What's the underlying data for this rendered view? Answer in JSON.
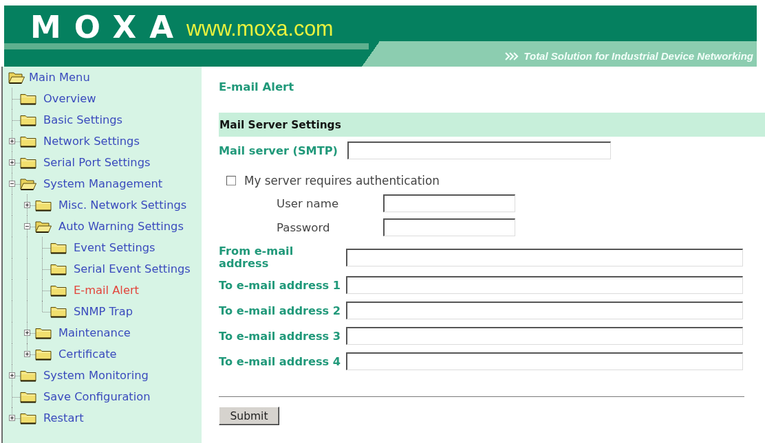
{
  "header": {
    "logo": "MOXA",
    "website": "www.moxa.com",
    "tagline": "Total Solution for Industrial Device Networking"
  },
  "menu": {
    "title": "Main Menu",
    "expanded": true,
    "items": [
      {
        "label": "Overview",
        "kind": "leaf",
        "expanded": false,
        "selected": false
      },
      {
        "label": "Basic Settings",
        "kind": "leaf",
        "expanded": false,
        "selected": false
      },
      {
        "label": "Network Settings",
        "kind": "branch",
        "expanded": false,
        "selected": false
      },
      {
        "label": "Serial Port Settings",
        "kind": "branch",
        "expanded": false,
        "selected": false
      },
      {
        "label": "System Management",
        "kind": "branch",
        "expanded": true,
        "selected": false,
        "children": [
          {
            "label": "Misc. Network Settings",
            "kind": "branch",
            "expanded": false,
            "selected": false
          },
          {
            "label": "Auto Warning Settings",
            "kind": "branch",
            "expanded": true,
            "selected": false,
            "children": [
              {
                "label": "Event Settings",
                "kind": "leaf",
                "expanded": false,
                "selected": false
              },
              {
                "label": "Serial Event Settings",
                "kind": "leaf",
                "expanded": false,
                "selected": false
              },
              {
                "label": "E-mail Alert",
                "kind": "leaf",
                "expanded": false,
                "selected": true
              },
              {
                "label": "SNMP Trap",
                "kind": "leaf",
                "expanded": false,
                "selected": false
              }
            ]
          },
          {
            "label": "Maintenance",
            "kind": "branch",
            "expanded": false,
            "selected": false
          },
          {
            "label": "Certificate",
            "kind": "branch",
            "expanded": false,
            "selected": false
          }
        ]
      },
      {
        "label": "System Monitoring",
        "kind": "branch",
        "expanded": false,
        "selected": false
      },
      {
        "label": "Save Configuration",
        "kind": "leaf",
        "expanded": false,
        "selected": false
      },
      {
        "label": "Restart",
        "kind": "branch",
        "expanded": false,
        "selected": false
      }
    ]
  },
  "content": {
    "title": "E-mail Alert",
    "section": "Mail Server Settings",
    "smtp": {
      "label": "Mail server (SMTP)"
    },
    "authentication": {
      "label": "My server requires authentication",
      "checked": false
    },
    "credentials": [
      {
        "label": "User name"
      },
      {
        "label": "Password"
      }
    ],
    "addresses": [
      {
        "label": "From e-mail address"
      },
      {
        "label": "To e-mail address 1"
      },
      {
        "label": "To e-mail address 2"
      },
      {
        "label": "To e-mail address 3"
      },
      {
        "label": "To e-mail address 4"
      }
    ],
    "submit": "Submit"
  }
}
